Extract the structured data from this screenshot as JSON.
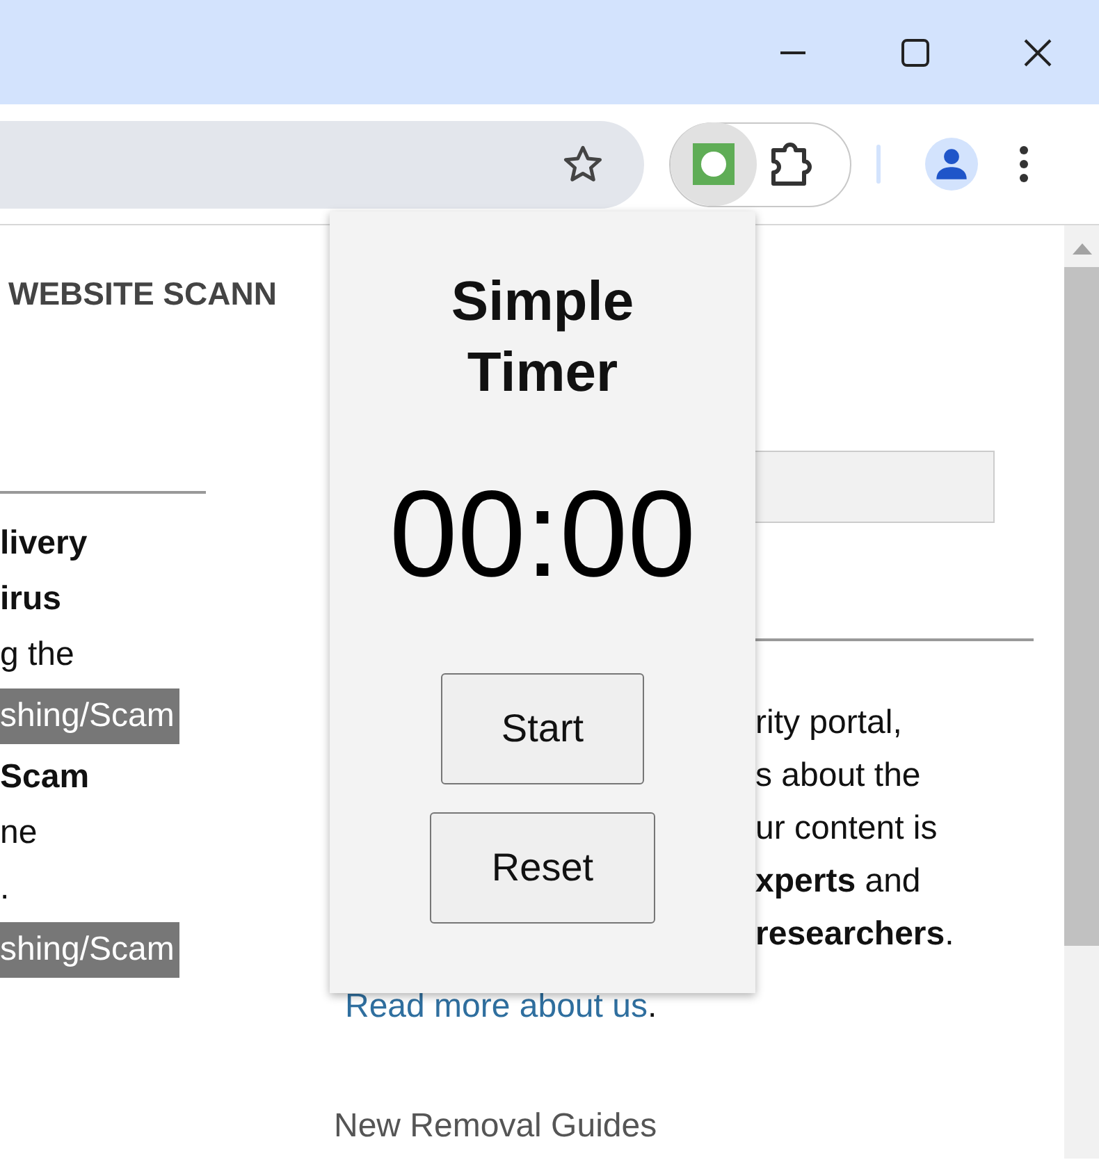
{
  "browser": {
    "extension_active": true
  },
  "page": {
    "heading": "WEBSITE SCANN",
    "left_items": [
      {
        "kind": "title",
        "text": "livery"
      },
      {
        "kind": "title",
        "text": "irus"
      },
      {
        "kind": "text",
        "text": "g the"
      },
      {
        "kind": "tag",
        "text": "shing/Scam"
      },
      {
        "kind": "title",
        "text": "Scam"
      },
      {
        "kind": "text",
        "text": "ne"
      },
      {
        "kind": "text",
        "text": "."
      },
      {
        "kind": "tag",
        "text": "shing/Scam"
      }
    ],
    "about_lines": [
      "rity portal,",
      "s about the",
      "ur content is",
      "**xperts** and",
      "**researchers**."
    ],
    "read_more": {
      "link": "Read more about us",
      "after": "."
    },
    "section_title": "New Removal Guides"
  },
  "popup": {
    "title": "Simple Timer",
    "time": "00:00",
    "buttons": [
      "Start",
      "Reset"
    ]
  }
}
